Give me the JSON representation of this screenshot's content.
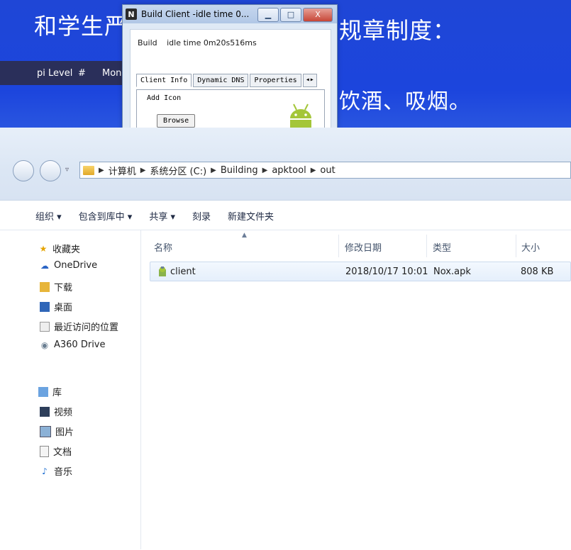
{
  "background": {
    "line1_left": "和学生严",
    "line1_right": "规章制度：",
    "line2_right": "饮酒、吸烟。",
    "header": {
      "col1": "pi Level",
      "col2": "#",
      "col3": "Moni"
    }
  },
  "dialog": {
    "title": "Build Client  -idle time 0...",
    "logo_letter": "N",
    "status_label": "Build",
    "status_value": "idle time 0m20s516ms",
    "tabs": [
      "Client Info",
      "Dynamic DNS",
      "Properties"
    ],
    "group_label": "Add Icon",
    "browse_label": "Browse"
  },
  "explorer": {
    "breadcrumb": [
      "计算机",
      "系统分区 (C:)",
      "Building",
      "apktool",
      "out"
    ],
    "toolbar": [
      "组织 ▾",
      "包含到库中 ▾",
      "共享 ▾",
      "刻录",
      "新建文件夹"
    ],
    "sidebar": {
      "favorites_label": "收藏夹",
      "favorites": [
        "OneDrive",
        "下载",
        "桌面",
        "最近访问的位置",
        "A360 Drive"
      ],
      "libraries_label": "库",
      "libraries": [
        "视频",
        "图片",
        "文档",
        "音乐"
      ]
    },
    "columns": {
      "name": "名称",
      "date": "修改日期",
      "type": "类型",
      "size": "大小"
    },
    "files": [
      {
        "name": "client",
        "date": "2018/10/17 10:01",
        "type": "Nox.apk",
        "size": "808 KB"
      }
    ]
  },
  "colors": {
    "desktop_blue": "#1f46d6",
    "android_green": "#a4c639"
  }
}
